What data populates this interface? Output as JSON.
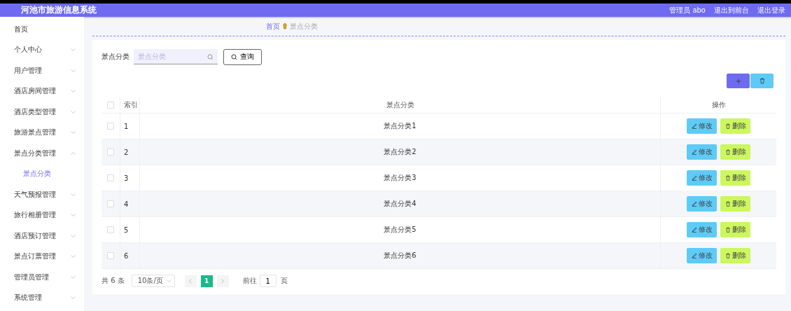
{
  "header": {
    "title": "河池市旅游信息系统",
    "user": "管理员 abo",
    "links": [
      "退出到前台",
      "退出登录"
    ]
  },
  "sidebar": {
    "items": [
      {
        "label": "首页",
        "kind": "link",
        "selected": false
      },
      {
        "label": "个人中心",
        "kind": "menu",
        "expanded": false
      },
      {
        "label": "用户管理",
        "kind": "menu",
        "expanded": false
      },
      {
        "label": "酒店房间管理",
        "kind": "menu",
        "expanded": false
      },
      {
        "label": "酒店类型管理",
        "kind": "menu",
        "expanded": false
      },
      {
        "label": "旅游景点管理",
        "kind": "menu",
        "expanded": false
      },
      {
        "label": "景点分类管理",
        "kind": "menu",
        "expanded": true,
        "children": [
          {
            "label": "景点分类",
            "kind": "link",
            "selected": true
          }
        ]
      },
      {
        "label": "天气预报管理",
        "kind": "menu",
        "expanded": false
      },
      {
        "label": "旅行相册管理",
        "kind": "menu",
        "expanded": false
      },
      {
        "label": "酒店预订管理",
        "kind": "menu",
        "expanded": false
      },
      {
        "label": "景点订票管理",
        "kind": "menu",
        "expanded": false
      },
      {
        "label": "管理员管理",
        "kind": "menu",
        "expanded": false
      },
      {
        "label": "系统管理",
        "kind": "menu",
        "expanded": false
      }
    ]
  },
  "breadcrumb": [
    "首页",
    "景点分类"
  ],
  "search": {
    "label": "景点分类",
    "placeholder": "景点分类",
    "button": "查询"
  },
  "table": {
    "columns": [
      "索引",
      "景点分类",
      "操作"
    ],
    "all_checked": false,
    "rows": [
      {
        "checked": false,
        "index": "1",
        "category": "景点分类1",
        "actions": [
          "修改",
          "删除"
        ]
      },
      {
        "checked": false,
        "index": "2",
        "category": "景点分类2",
        "actions": [
          "修改",
          "删除"
        ]
      },
      {
        "checked": false,
        "index": "3",
        "category": "景点分类3",
        "actions": [
          "修改",
          "删除"
        ]
      },
      {
        "checked": false,
        "index": "4",
        "category": "景点分类4",
        "actions": [
          "修改",
          "删除"
        ]
      },
      {
        "checked": false,
        "index": "5",
        "category": "景点分类5",
        "actions": [
          "修改",
          "删除"
        ]
      },
      {
        "checked": false,
        "index": "6",
        "category": "景点分类6",
        "actions": [
          "修改",
          "删除"
        ]
      }
    ]
  },
  "pagination": {
    "total": "共 6 条",
    "page_size": "10条/页",
    "pages": [
      {
        "label": "1",
        "selected": true
      }
    ],
    "goto_label": "前往",
    "goto_value": "1",
    "goto_suffix": "页"
  }
}
